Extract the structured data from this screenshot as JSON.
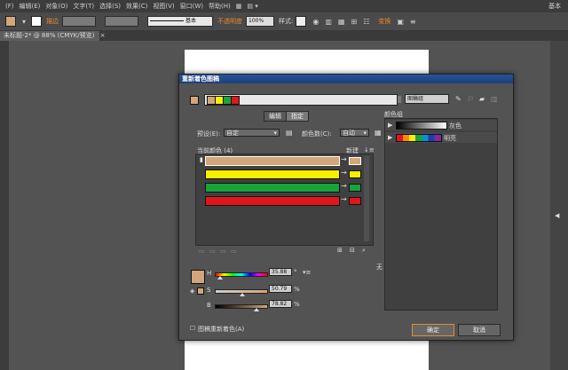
{
  "menubar": {
    "items": [
      "(F)",
      "编辑(E)",
      "对象(O)",
      "文字(T)",
      "选择(S)",
      "效果(C)",
      "视图(V)",
      "窗口(W)",
      "帮助(H)"
    ],
    "right_label": "基本"
  },
  "control_bar": {
    "tracing_label": "描边",
    "stroke_style": "基本",
    "opacity_label": "不透明度",
    "opacity_value": "100%",
    "style_label": "样式:",
    "transform_label": "变换"
  },
  "doc_tab": {
    "title": "未标题-2* @ 88% (CMYK/预览)",
    "close": "×"
  },
  "colors": {
    "tan": "#d2a679",
    "yellow": "#f7f000",
    "green": "#1aa33a",
    "red": "#e0161d",
    "accent_title": "#2a5298",
    "orange_label": "#e88a2c"
  },
  "dialog": {
    "title": "重新着色图稿",
    "group_field_placeholder": "",
    "group_name": "图稿组",
    "tabs": [
      "编辑",
      "指定"
    ],
    "preset_label": "预设(E):",
    "preset_value": "自定",
    "color_count_label": "颜色数(C):",
    "color_count_value": "自动",
    "current_colors_label": "当前颜色 (4)",
    "new_label": "新建",
    "rows": [
      {
        "name": "tan"
      },
      {
        "name": "yellow"
      },
      {
        "name": "green"
      },
      {
        "name": "red"
      }
    ],
    "h_label": "H",
    "s_label": "S",
    "b_label": "B",
    "h_value": "35.88",
    "s_value": "50.79",
    "b_value": "78.82",
    "degree": "°",
    "percent": "%",
    "none_label": "无",
    "recolor_checkbox_label": "图稿重新着色(A)",
    "ok_button": "确定",
    "cancel_button": "取消",
    "color_groups_label": "颜色组",
    "group_gray": "灰色",
    "group_bright": "明亮"
  }
}
